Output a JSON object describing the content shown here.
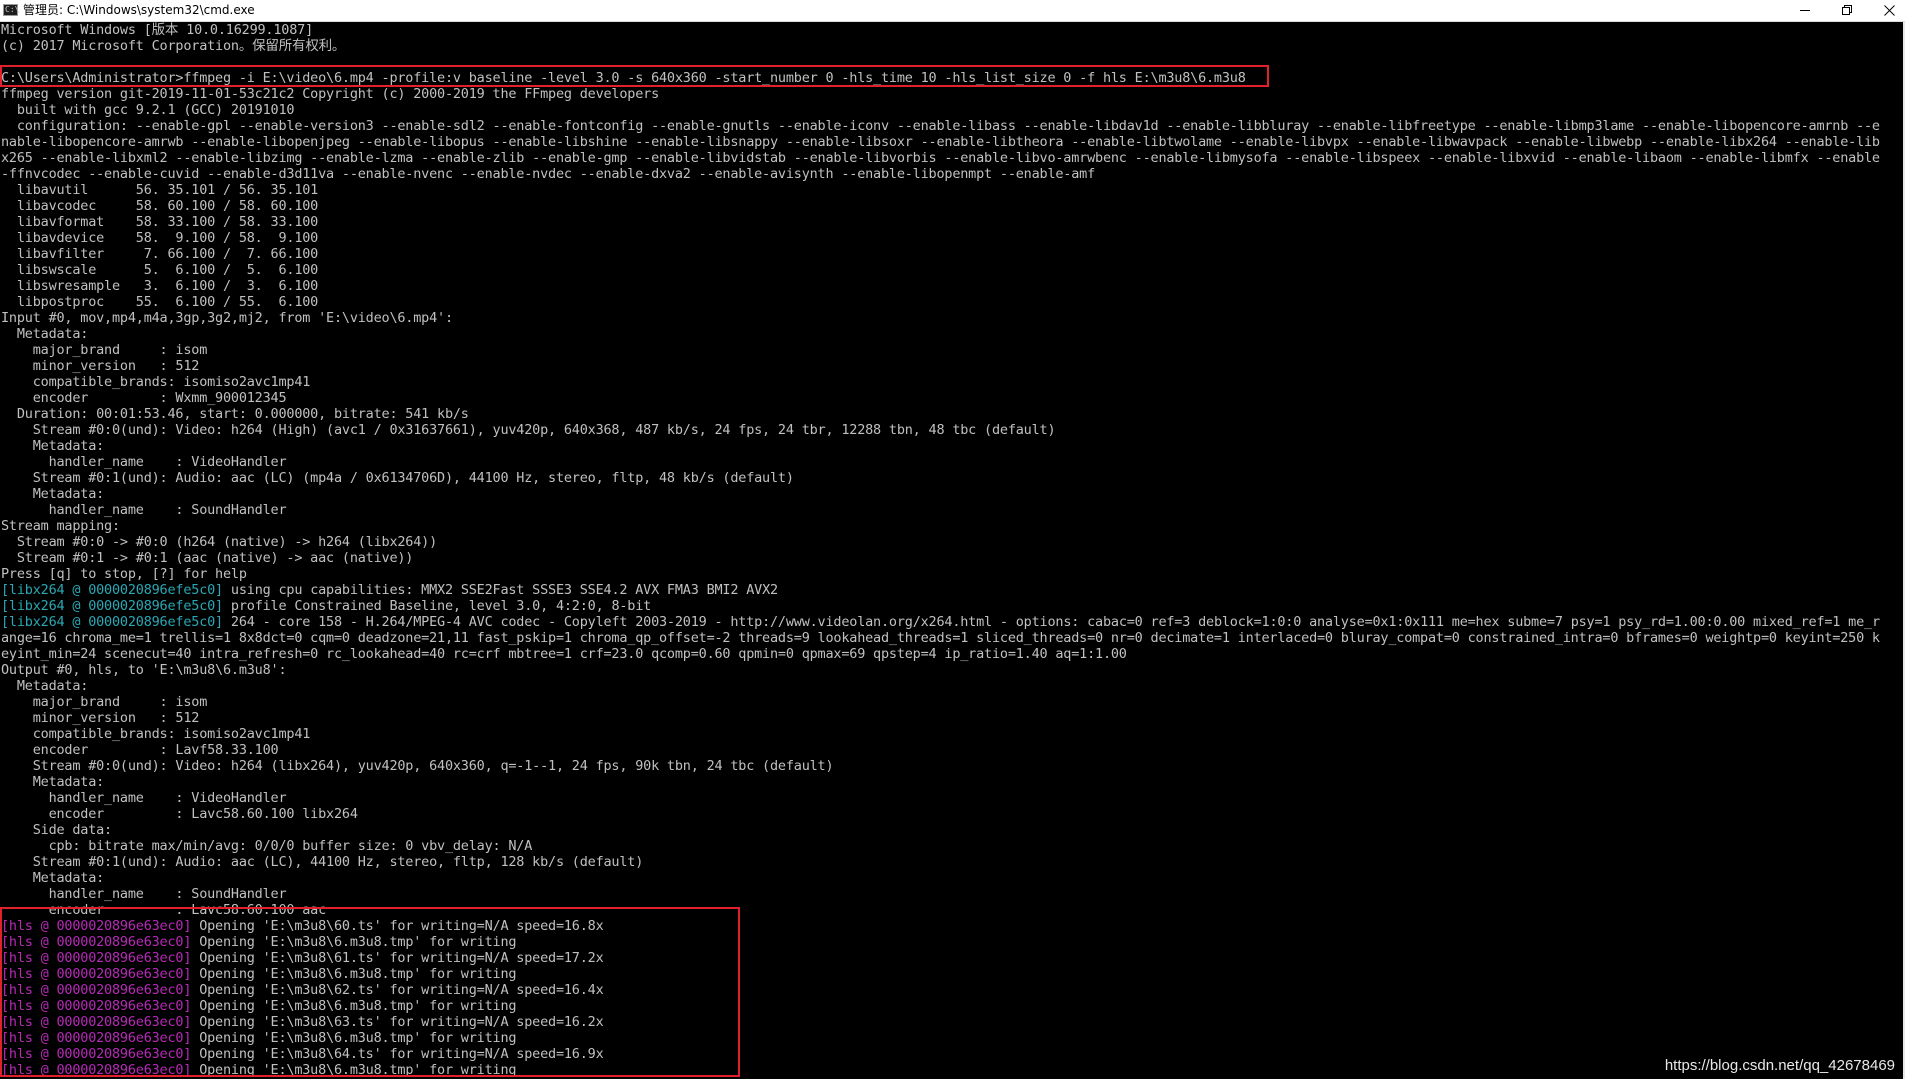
{
  "window": {
    "title": "管理员: C:\\Windows\\system32\\cmd.exe",
    "app_icon_text": "C:\\",
    "controls": {
      "minimize_icon": "minimize-icon",
      "maximize_icon": "restore-icon",
      "close_icon": "close-icon"
    }
  },
  "console": {
    "lines": [
      {
        "segments": [
          {
            "text": "Microsoft Windows [版本 10.0.16299.1087]",
            "style": "normal"
          }
        ]
      },
      {
        "segments": [
          {
            "text": "(c) 2017 Microsoft Corporation。保留所有权利。",
            "style": "normal"
          }
        ]
      },
      {
        "segments": [
          {
            "text": "",
            "style": "normal"
          }
        ]
      },
      {
        "segments": [
          {
            "text": "C:\\Users\\Administrator>ffmpeg -i E:\\video\\6.mp4 -profile:v baseline -level 3.0 -s 640x360 -start_number 0 -hls_time 10 -hls_list_size 0 -f hls E:\\m3u8\\6.m3u8",
            "style": "normal"
          }
        ]
      },
      {
        "segments": [
          {
            "text": "ffmpeg version git-2019-11-01-53c21c2 Copyright (c) 2000-2019 the FFmpeg developers",
            "style": "normal"
          }
        ]
      },
      {
        "segments": [
          {
            "text": "  built with gcc 9.2.1 (GCC) 20191010",
            "style": "normal"
          }
        ]
      },
      {
        "segments": [
          {
            "text": "  configuration: --enable-gpl --enable-version3 --enable-sdl2 --enable-fontconfig --enable-gnutls --enable-iconv --enable-libass --enable-libdav1d --enable-libbluray --enable-libfreetype --enable-libmp3lame --enable-libopencore-amrnb --e",
            "style": "normal"
          }
        ]
      },
      {
        "segments": [
          {
            "text": "nable-libopencore-amrwb --enable-libopenjpeg --enable-libopus --enable-libshine --enable-libsnappy --enable-libsoxr --enable-libtheora --enable-libtwolame --enable-libvpx --enable-libwavpack --enable-libwebp --enable-libx264 --enable-lib",
            "style": "normal"
          }
        ]
      },
      {
        "segments": [
          {
            "text": "x265 --enable-libxml2 --enable-libzimg --enable-lzma --enable-zlib --enable-gmp --enable-libvidstab --enable-libvorbis --enable-libvo-amrwbenc --enable-libmysofa --enable-libspeex --enable-libxvid --enable-libaom --enable-libmfx --enable",
            "style": "normal"
          }
        ]
      },
      {
        "segments": [
          {
            "text": "-ffnvcodec --enable-cuvid --enable-d3d11va --enable-nvenc --enable-nvdec --enable-dxva2 --enable-avisynth --enable-libopenmpt --enable-amf",
            "style": "normal"
          }
        ]
      },
      {
        "segments": [
          {
            "text": "  libavutil      56. 35.101 / 56. 35.101",
            "style": "normal"
          }
        ]
      },
      {
        "segments": [
          {
            "text": "  libavcodec     58. 60.100 / 58. 60.100",
            "style": "normal"
          }
        ]
      },
      {
        "segments": [
          {
            "text": "  libavformat    58. 33.100 / 58. 33.100",
            "style": "normal"
          }
        ]
      },
      {
        "segments": [
          {
            "text": "  libavdevice    58.  9.100 / 58.  9.100",
            "style": "normal"
          }
        ]
      },
      {
        "segments": [
          {
            "text": "  libavfilter     7. 66.100 /  7. 66.100",
            "style": "normal"
          }
        ]
      },
      {
        "segments": [
          {
            "text": "  libswscale      5.  6.100 /  5.  6.100",
            "style": "normal"
          }
        ]
      },
      {
        "segments": [
          {
            "text": "  libswresample   3.  6.100 /  3.  6.100",
            "style": "normal"
          }
        ]
      },
      {
        "segments": [
          {
            "text": "  libpostproc    55.  6.100 / 55.  6.100",
            "style": "normal"
          }
        ]
      },
      {
        "segments": [
          {
            "text": "Input #0, mov,mp4,m4a,3gp,3g2,mj2, from 'E:\\video\\6.mp4':",
            "style": "normal"
          }
        ]
      },
      {
        "segments": [
          {
            "text": "  Metadata:",
            "style": "normal"
          }
        ]
      },
      {
        "segments": [
          {
            "text": "    major_brand     : isom",
            "style": "normal"
          }
        ]
      },
      {
        "segments": [
          {
            "text": "    minor_version   : 512",
            "style": "normal"
          }
        ]
      },
      {
        "segments": [
          {
            "text": "    compatible_brands: isomiso2avc1mp41",
            "style": "normal"
          }
        ]
      },
      {
        "segments": [
          {
            "text": "    encoder         : Wxmm_900012345",
            "style": "normal"
          }
        ]
      },
      {
        "segments": [
          {
            "text": "  Duration: 00:01:53.46, start: 0.000000, bitrate: 541 kb/s",
            "style": "normal"
          }
        ]
      },
      {
        "segments": [
          {
            "text": "    Stream #0:0(und): Video: h264 (High) (avc1 / 0x31637661), yuv420p, 640x368, 487 kb/s, 24 fps, 24 tbr, 12288 tbn, 48 tbc (default)",
            "style": "normal"
          }
        ]
      },
      {
        "segments": [
          {
            "text": "    Metadata:",
            "style": "normal"
          }
        ]
      },
      {
        "segments": [
          {
            "text": "      handler_name    : VideoHandler",
            "style": "normal"
          }
        ]
      },
      {
        "segments": [
          {
            "text": "    Stream #0:1(und): Audio: aac (LC) (mp4a / 0x6134706D), 44100 Hz, stereo, fltp, 48 kb/s (default)",
            "style": "normal"
          }
        ]
      },
      {
        "segments": [
          {
            "text": "    Metadata:",
            "style": "normal"
          }
        ]
      },
      {
        "segments": [
          {
            "text": "      handler_name    : SoundHandler",
            "style": "normal"
          }
        ]
      },
      {
        "segments": [
          {
            "text": "Stream mapping:",
            "style": "normal"
          }
        ]
      },
      {
        "segments": [
          {
            "text": "  Stream #0:0 -> #0:0 (h264 (native) -> h264 (libx264))",
            "style": "normal"
          }
        ]
      },
      {
        "segments": [
          {
            "text": "  Stream #0:1 -> #0:1 (aac (native) -> aac (native))",
            "style": "normal"
          }
        ]
      },
      {
        "segments": [
          {
            "text": "Press [q] to stop, [?] for help",
            "style": "normal"
          }
        ]
      },
      {
        "segments": [
          {
            "text": "[libx264 @ 0000020896efe5c0]",
            "style": "cyan"
          },
          {
            "text": " using cpu capabilities: MMX2 SSE2Fast SSSE3 SSE4.2 AVX FMA3 BMI2 AVX2",
            "style": "normal"
          }
        ]
      },
      {
        "segments": [
          {
            "text": "[libx264 @ 0000020896efe5c0]",
            "style": "cyan"
          },
          {
            "text": " profile Constrained Baseline, level 3.0, 4:2:0, 8-bit",
            "style": "normal"
          }
        ]
      },
      {
        "segments": [
          {
            "text": "[libx264 @ 0000020896efe5c0]",
            "style": "cyan"
          },
          {
            "text": " 264 - core 158 - H.264/MPEG-4 AVC codec - Copyleft 2003-2019 - http://www.videolan.org/x264.html - options: cabac=0 ref=3 deblock=1:0:0 analyse=0x1:0x111 me=hex subme=7 psy=1 psy_rd=1.00:0.00 mixed_ref=1 me_r",
            "style": "normal"
          }
        ]
      },
      {
        "segments": [
          {
            "text": "ange=16 chroma_me=1 trellis=1 8x8dct=0 cqm=0 deadzone=21,11 fast_pskip=1 chroma_qp_offset=-2 threads=9 lookahead_threads=1 sliced_threads=0 nr=0 decimate=1 interlaced=0 bluray_compat=0 constrained_intra=0 bframes=0 weightp=0 keyint=250 k",
            "style": "normal"
          }
        ]
      },
      {
        "segments": [
          {
            "text": "eyint_min=24 scenecut=40 intra_refresh=0 rc_lookahead=40 rc=crf mbtree=1 crf=23.0 qcomp=0.60 qpmin=0 qpmax=69 qpstep=4 ip_ratio=1.40 aq=1:1.00",
            "style": "normal"
          }
        ]
      },
      {
        "segments": [
          {
            "text": "Output #0, hls, to 'E:\\m3u8\\6.m3u8':",
            "style": "normal"
          }
        ]
      },
      {
        "segments": [
          {
            "text": "  Metadata:",
            "style": "normal"
          }
        ]
      },
      {
        "segments": [
          {
            "text": "    major_brand     : isom",
            "style": "normal"
          }
        ]
      },
      {
        "segments": [
          {
            "text": "    minor_version   : 512",
            "style": "normal"
          }
        ]
      },
      {
        "segments": [
          {
            "text": "    compatible_brands: isomiso2avc1mp41",
            "style": "normal"
          }
        ]
      },
      {
        "segments": [
          {
            "text": "    encoder         : Lavf58.33.100",
            "style": "normal"
          }
        ]
      },
      {
        "segments": [
          {
            "text": "    Stream #0:0(und): Video: h264 (libx264), yuv420p, 640x360, q=-1--1, 24 fps, 90k tbn, 24 tbc (default)",
            "style": "normal"
          }
        ]
      },
      {
        "segments": [
          {
            "text": "    Metadata:",
            "style": "normal"
          }
        ]
      },
      {
        "segments": [
          {
            "text": "      handler_name    : VideoHandler",
            "style": "normal"
          }
        ]
      },
      {
        "segments": [
          {
            "text": "      encoder         : Lavc58.60.100 libx264",
            "style": "normal"
          }
        ]
      },
      {
        "segments": [
          {
            "text": "    Side data:",
            "style": "normal"
          }
        ]
      },
      {
        "segments": [
          {
            "text": "      cpb: bitrate max/min/avg: 0/0/0 buffer size: 0 vbv_delay: N/A",
            "style": "normal"
          }
        ]
      },
      {
        "segments": [
          {
            "text": "    Stream #0:1(und): Audio: aac (LC), 44100 Hz, stereo, fltp, 128 kb/s (default)",
            "style": "normal"
          }
        ]
      },
      {
        "segments": [
          {
            "text": "    Metadata:",
            "style": "normal"
          }
        ]
      },
      {
        "segments": [
          {
            "text": "      handler_name    : SoundHandler",
            "style": "normal"
          }
        ]
      },
      {
        "segments": [
          {
            "text": "      encoder         : Lavc58.60.100 aac",
            "style": "normal"
          }
        ]
      },
      {
        "segments": [
          {
            "text": "[hls @ 0000020896e63ec0]",
            "style": "magenta"
          },
          {
            "text": " Opening 'E:\\m3u8\\60.ts' for writing=N/A speed=16.8x",
            "style": "normal"
          }
        ]
      },
      {
        "segments": [
          {
            "text": "[hls @ 0000020896e63ec0]",
            "style": "magenta"
          },
          {
            "text": " Opening 'E:\\m3u8\\6.m3u8.tmp' for writing",
            "style": "normal"
          }
        ]
      },
      {
        "segments": [
          {
            "text": "[hls @ 0000020896e63ec0]",
            "style": "magenta"
          },
          {
            "text": " Opening 'E:\\m3u8\\61.ts' for writing=N/A speed=17.2x",
            "style": "normal"
          }
        ]
      },
      {
        "segments": [
          {
            "text": "[hls @ 0000020896e63ec0]",
            "style": "magenta"
          },
          {
            "text": " Opening 'E:\\m3u8\\6.m3u8.tmp' for writing",
            "style": "normal"
          }
        ]
      },
      {
        "segments": [
          {
            "text": "[hls @ 0000020896e63ec0]",
            "style": "magenta"
          },
          {
            "text": " Opening 'E:\\m3u8\\62.ts' for writing=N/A speed=16.4x",
            "style": "normal"
          }
        ]
      },
      {
        "segments": [
          {
            "text": "[hls @ 0000020896e63ec0]",
            "style": "magenta"
          },
          {
            "text": " Opening 'E:\\m3u8\\6.m3u8.tmp' for writing",
            "style": "normal"
          }
        ]
      },
      {
        "segments": [
          {
            "text": "[hls @ 0000020896e63ec0]",
            "style": "magenta"
          },
          {
            "text": " Opening 'E:\\m3u8\\63.ts' for writing=N/A speed=16.2x",
            "style": "normal"
          }
        ]
      },
      {
        "segments": [
          {
            "text": "[hls @ 0000020896e63ec0]",
            "style": "magenta"
          },
          {
            "text": " Opening 'E:\\m3u8\\6.m3u8.tmp' for writing",
            "style": "normal"
          }
        ]
      },
      {
        "segments": [
          {
            "text": "[hls @ 0000020896e63ec0]",
            "style": "magenta"
          },
          {
            "text": " Opening 'E:\\m3u8\\64.ts' for writing=N/A speed=16.9x",
            "style": "normal"
          }
        ]
      },
      {
        "segments": [
          {
            "text": "[hls @ 0000020896e63ec0]",
            "style": "magenta"
          },
          {
            "text": " Opening 'E:\\m3u8\\6.m3u8.tmp' for writing",
            "style": "normal"
          }
        ]
      }
    ]
  },
  "highlights": {
    "color": "#e0202a",
    "regions": [
      "command-line",
      "hls-output"
    ]
  },
  "watermark": "https://blog.csdn.net/qq_42678469",
  "colors": {
    "console_bg": "#000000",
    "console_fg": "#c0c0c0",
    "libx264_tag": "#2aa8b4",
    "hls_tag": "#b829b8"
  }
}
